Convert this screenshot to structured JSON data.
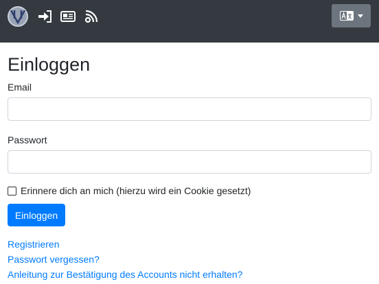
{
  "navbar": {
    "icons": [
      "logo-icon",
      "login-icon",
      "news-icon",
      "blog-icon"
    ],
    "language_button_icon": "translate-icon"
  },
  "login": {
    "title": "Einloggen",
    "email_label": "Email",
    "email_value": "",
    "password_label": "Passwort",
    "password_value": "",
    "remember_label": "Erinnere dich an mich (hierzu wird ein Cookie gesetzt)",
    "remember_checked": false,
    "submit_label": "Einloggen"
  },
  "links": {
    "register": "Registrieren",
    "forgot_password": "Passwort vergessen?",
    "resend_confirmation": "Anleitung zur Bestätigung des Accounts nicht erhalten?"
  },
  "colors": {
    "navbar_bg": "#343a40",
    "primary": "#007bff",
    "secondary": "#6c757d"
  }
}
